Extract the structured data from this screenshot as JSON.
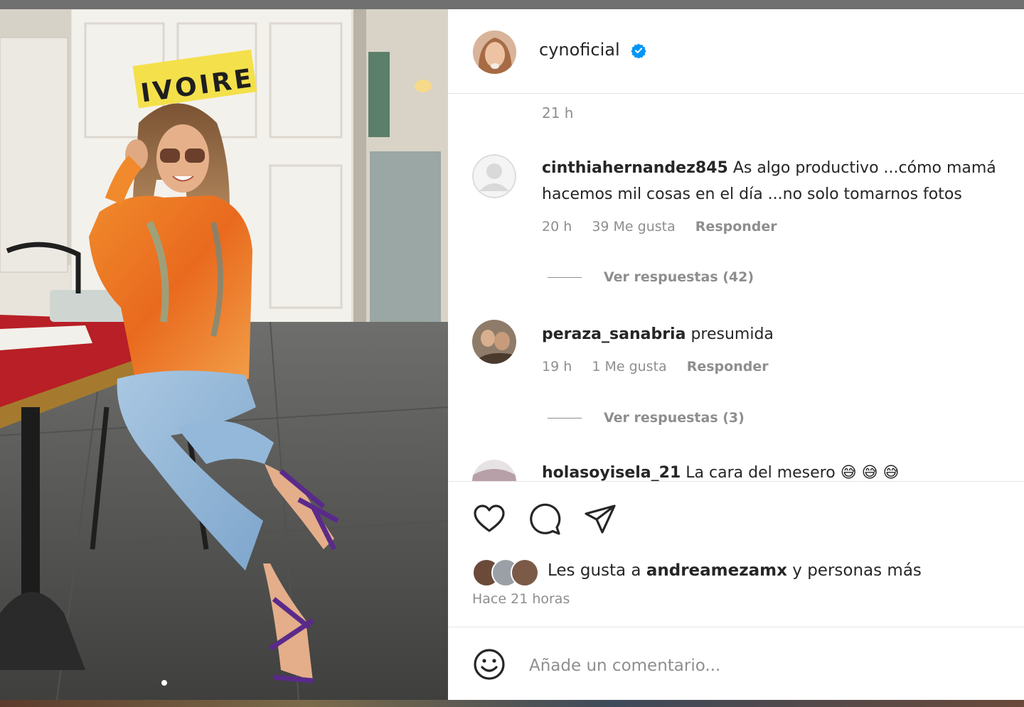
{
  "post": {
    "username": "cynoficial",
    "verified": true,
    "sign_text": "IVOIRE",
    "carousel_index": 1,
    "carousel_total": 2
  },
  "comments": {
    "caption_time": "21 h",
    "items": [
      {
        "username": "cinthiahernandez845",
        "text": "As algo productivo ...cómo mamá",
        "text_line2": "hacemos mil cosas en el día ...no solo tomarnos fotos",
        "time": "20 h",
        "likes": "39 Me gusta",
        "reply_label": "Responder",
        "view_replies": "Ver respuestas (42)"
      },
      {
        "username": "peraza_sanabria",
        "text": "presumida",
        "time": "19 h",
        "likes": "1 Me gusta",
        "reply_label": "Responder",
        "view_replies": "Ver respuestas (3)"
      },
      {
        "username": "holasoyisela_21",
        "text": "La cara del mesero 😅 😅 😅"
      }
    ]
  },
  "actions": {
    "icons": [
      "heart-icon",
      "comment-icon",
      "share-icon"
    ],
    "likes_prefix": "Les gusta a",
    "likes_user": "andreamezamx",
    "likes_suffix": "y personas más",
    "post_age": "Hace 21 horas"
  },
  "composer": {
    "placeholder": "Añade un comentario..."
  },
  "colors": {
    "verified_blue": "#0095f6",
    "muted_text": "#8e8e8e",
    "text": "#262626",
    "divider": "#e6e6e6"
  }
}
